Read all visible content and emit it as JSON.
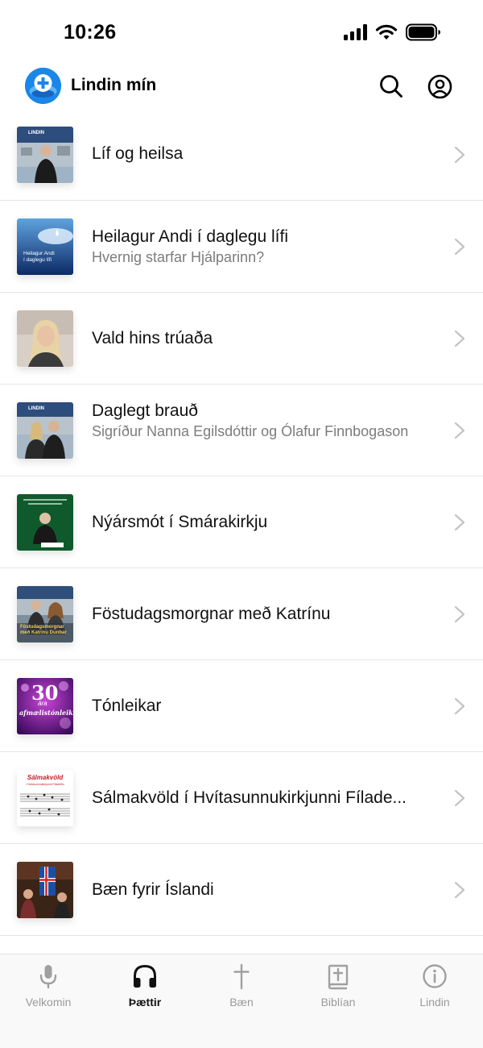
{
  "status": {
    "time": "10:26"
  },
  "header": {
    "title": "Lindin mín"
  },
  "shows": [
    {
      "title": "Líf og heilsa",
      "subtitle": ""
    },
    {
      "title": "Heilagur Andi í daglegu lífi",
      "subtitle": "Hvernig starfar Hjálparinn?"
    },
    {
      "title": "Vald hins trúaða",
      "subtitle": ""
    },
    {
      "title": "Daglegt  brauð",
      "subtitle": "Sigríður Nanna Egilsdóttir og Ólafur Finnbogason"
    },
    {
      "title": "Nýársmót í Smárakirkju",
      "subtitle": ""
    },
    {
      "title": "Föstudagsmorgnar með Katrínu",
      "subtitle": ""
    },
    {
      "title": "Tónleikar",
      "subtitle": ""
    },
    {
      "title": "Sálmakvöld í Hvítasunnukirkjunni Fílade...",
      "subtitle": ""
    },
    {
      "title": "Bæn fyrir Íslandi",
      "subtitle": ""
    }
  ],
  "thumb_text": {
    "lindin": "LINDIN",
    "heilagur_line1": "Heilagur Andi",
    "heilagur_line2": "í daglegu lífi",
    "fostudags_line1": "Föstudagsmorgnar",
    "fostudags_line2": "með Katrínu Dunbar",
    "tonleikar_number": "30",
    "tonleikar_line1": "ára",
    "tonleikar_line2": "afmælistónleikar",
    "salm_title": "Sálmakvöld",
    "salm_sub": "í Hvítasunnukirkjunni Fíladelfíu"
  },
  "tabs": [
    {
      "label": "Velkomin",
      "icon": "microphone-icon",
      "active": false
    },
    {
      "label": "Þættir",
      "icon": "headphones-icon",
      "active": true
    },
    {
      "label": "Bæn",
      "icon": "cross-icon",
      "active": false
    },
    {
      "label": "Biblían",
      "icon": "bible-icon",
      "active": false
    },
    {
      "label": "Lindin",
      "icon": "info-icon",
      "active": false
    }
  ],
  "colors": {
    "accent": "#1a86e8",
    "active_tab": "#111111",
    "inactive_tab": "#9a9a9a",
    "subtitle": "#7c7c7c",
    "divider": "#e4e4e4"
  }
}
